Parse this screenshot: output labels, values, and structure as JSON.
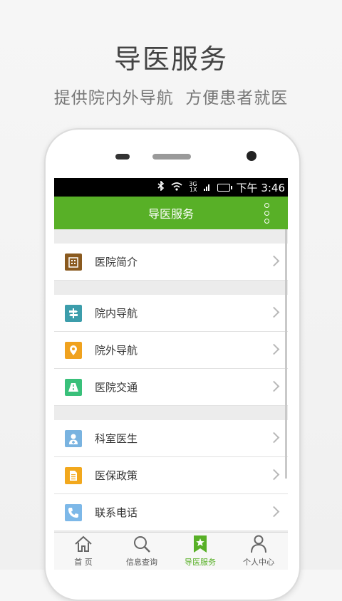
{
  "banner": {
    "title": "导医服务",
    "subtitle": "提供院内外导航  方便患者就医"
  },
  "statusbar": {
    "net_top": "3G",
    "net_bottom": "1X",
    "time": "下午 3:46"
  },
  "titlebar": {
    "title": "导医服务"
  },
  "menu": [
    {
      "label": "医院简介",
      "icon": "building-icon",
      "color": "#8a5a1f"
    },
    {
      "label": "院内导航",
      "icon": "signpost-icon",
      "color": "#3c9dab"
    },
    {
      "label": "院外导航",
      "icon": "map-pin-icon",
      "color": "#f0a21e"
    },
    {
      "label": "医院交通",
      "icon": "road-icon",
      "color": "#39c07a"
    },
    {
      "label": "科室医生",
      "icon": "doctor-icon",
      "color": "#79b3e0"
    },
    {
      "label": "医保政策",
      "icon": "document-icon",
      "color": "#f2a81d"
    },
    {
      "label": "联系电话",
      "icon": "phone-icon",
      "color": "#7db8e8"
    }
  ],
  "tabs": [
    {
      "label": "首  页",
      "icon": "home-icon"
    },
    {
      "label": "信息查询",
      "icon": "search-icon"
    },
    {
      "label": "导医服务",
      "icon": "bookmark-star-icon",
      "active": true
    },
    {
      "label": "个人中心",
      "icon": "person-icon"
    }
  ],
  "colors": {
    "accent_green": "#58b027"
  }
}
